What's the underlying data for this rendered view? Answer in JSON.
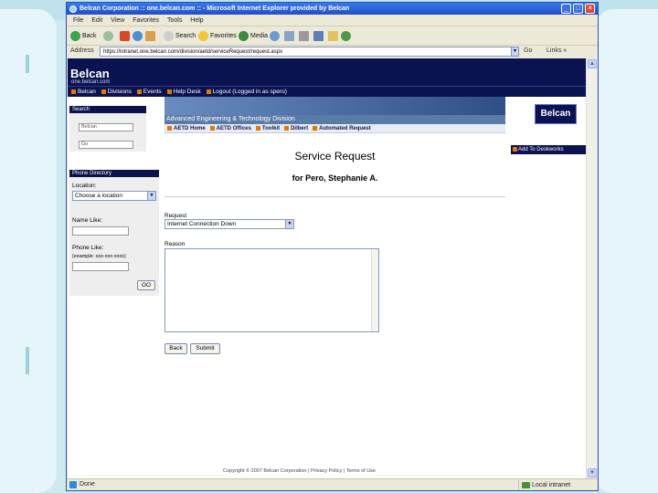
{
  "window": {
    "title": "Belcan Corporation :: one.belcan.com :: - Microsoft Internet Explorer provided by Belcan",
    "min": "_",
    "max": "□",
    "close": "✕"
  },
  "menu": [
    "File",
    "Edit",
    "View",
    "Favorites",
    "Tools",
    "Help"
  ],
  "toolbar": {
    "back": "Back",
    "search": "Search",
    "favorites": "Favorites",
    "media": "Media"
  },
  "address": {
    "label": "Address",
    "url": "https://intranet.one.belcan.com/division/aetd/serviceRequest/request.aspx",
    "go": "Go",
    "links": "Links »"
  },
  "site": {
    "logo": "Belcan",
    "domain": "one.belcan.com",
    "nav": [
      "Belcan",
      "Divisions",
      "Events",
      "Help Desk",
      "Logout (Logged in as spero)"
    ]
  },
  "search_panel": {
    "title": "Search",
    "field_value": "Belcan",
    "field2": "Go"
  },
  "directory_panel": {
    "title": "Phone Directory",
    "location_label": "Location:",
    "location_value": "Choose a location",
    "name_label": "Name Like:",
    "phone_label": "Phone Like:",
    "phone_hint": "(example: xxx-xxx-xxxx)",
    "go": "GO"
  },
  "right": {
    "logo": "Belcan",
    "deskworks": "Add To Deskworks"
  },
  "division": {
    "title": "Advanced Engineering & Technology Division",
    "links": [
      "AETD Home",
      "AETD Offices",
      "Toolkit",
      "Dilbert",
      "Automated Request"
    ]
  },
  "form": {
    "title": "Service Request",
    "for": "for Pero, Stephanie A.",
    "request_label": "Request",
    "request_value": "Internet Connection Down",
    "reason_label": "Reason",
    "back": "Back",
    "submit": "Submit"
  },
  "footer": "Copyright © 2007 Belcan Corporation | Privacy Policy | Terms of Use",
  "status": {
    "text": "Done",
    "zone": "Local intranet"
  }
}
